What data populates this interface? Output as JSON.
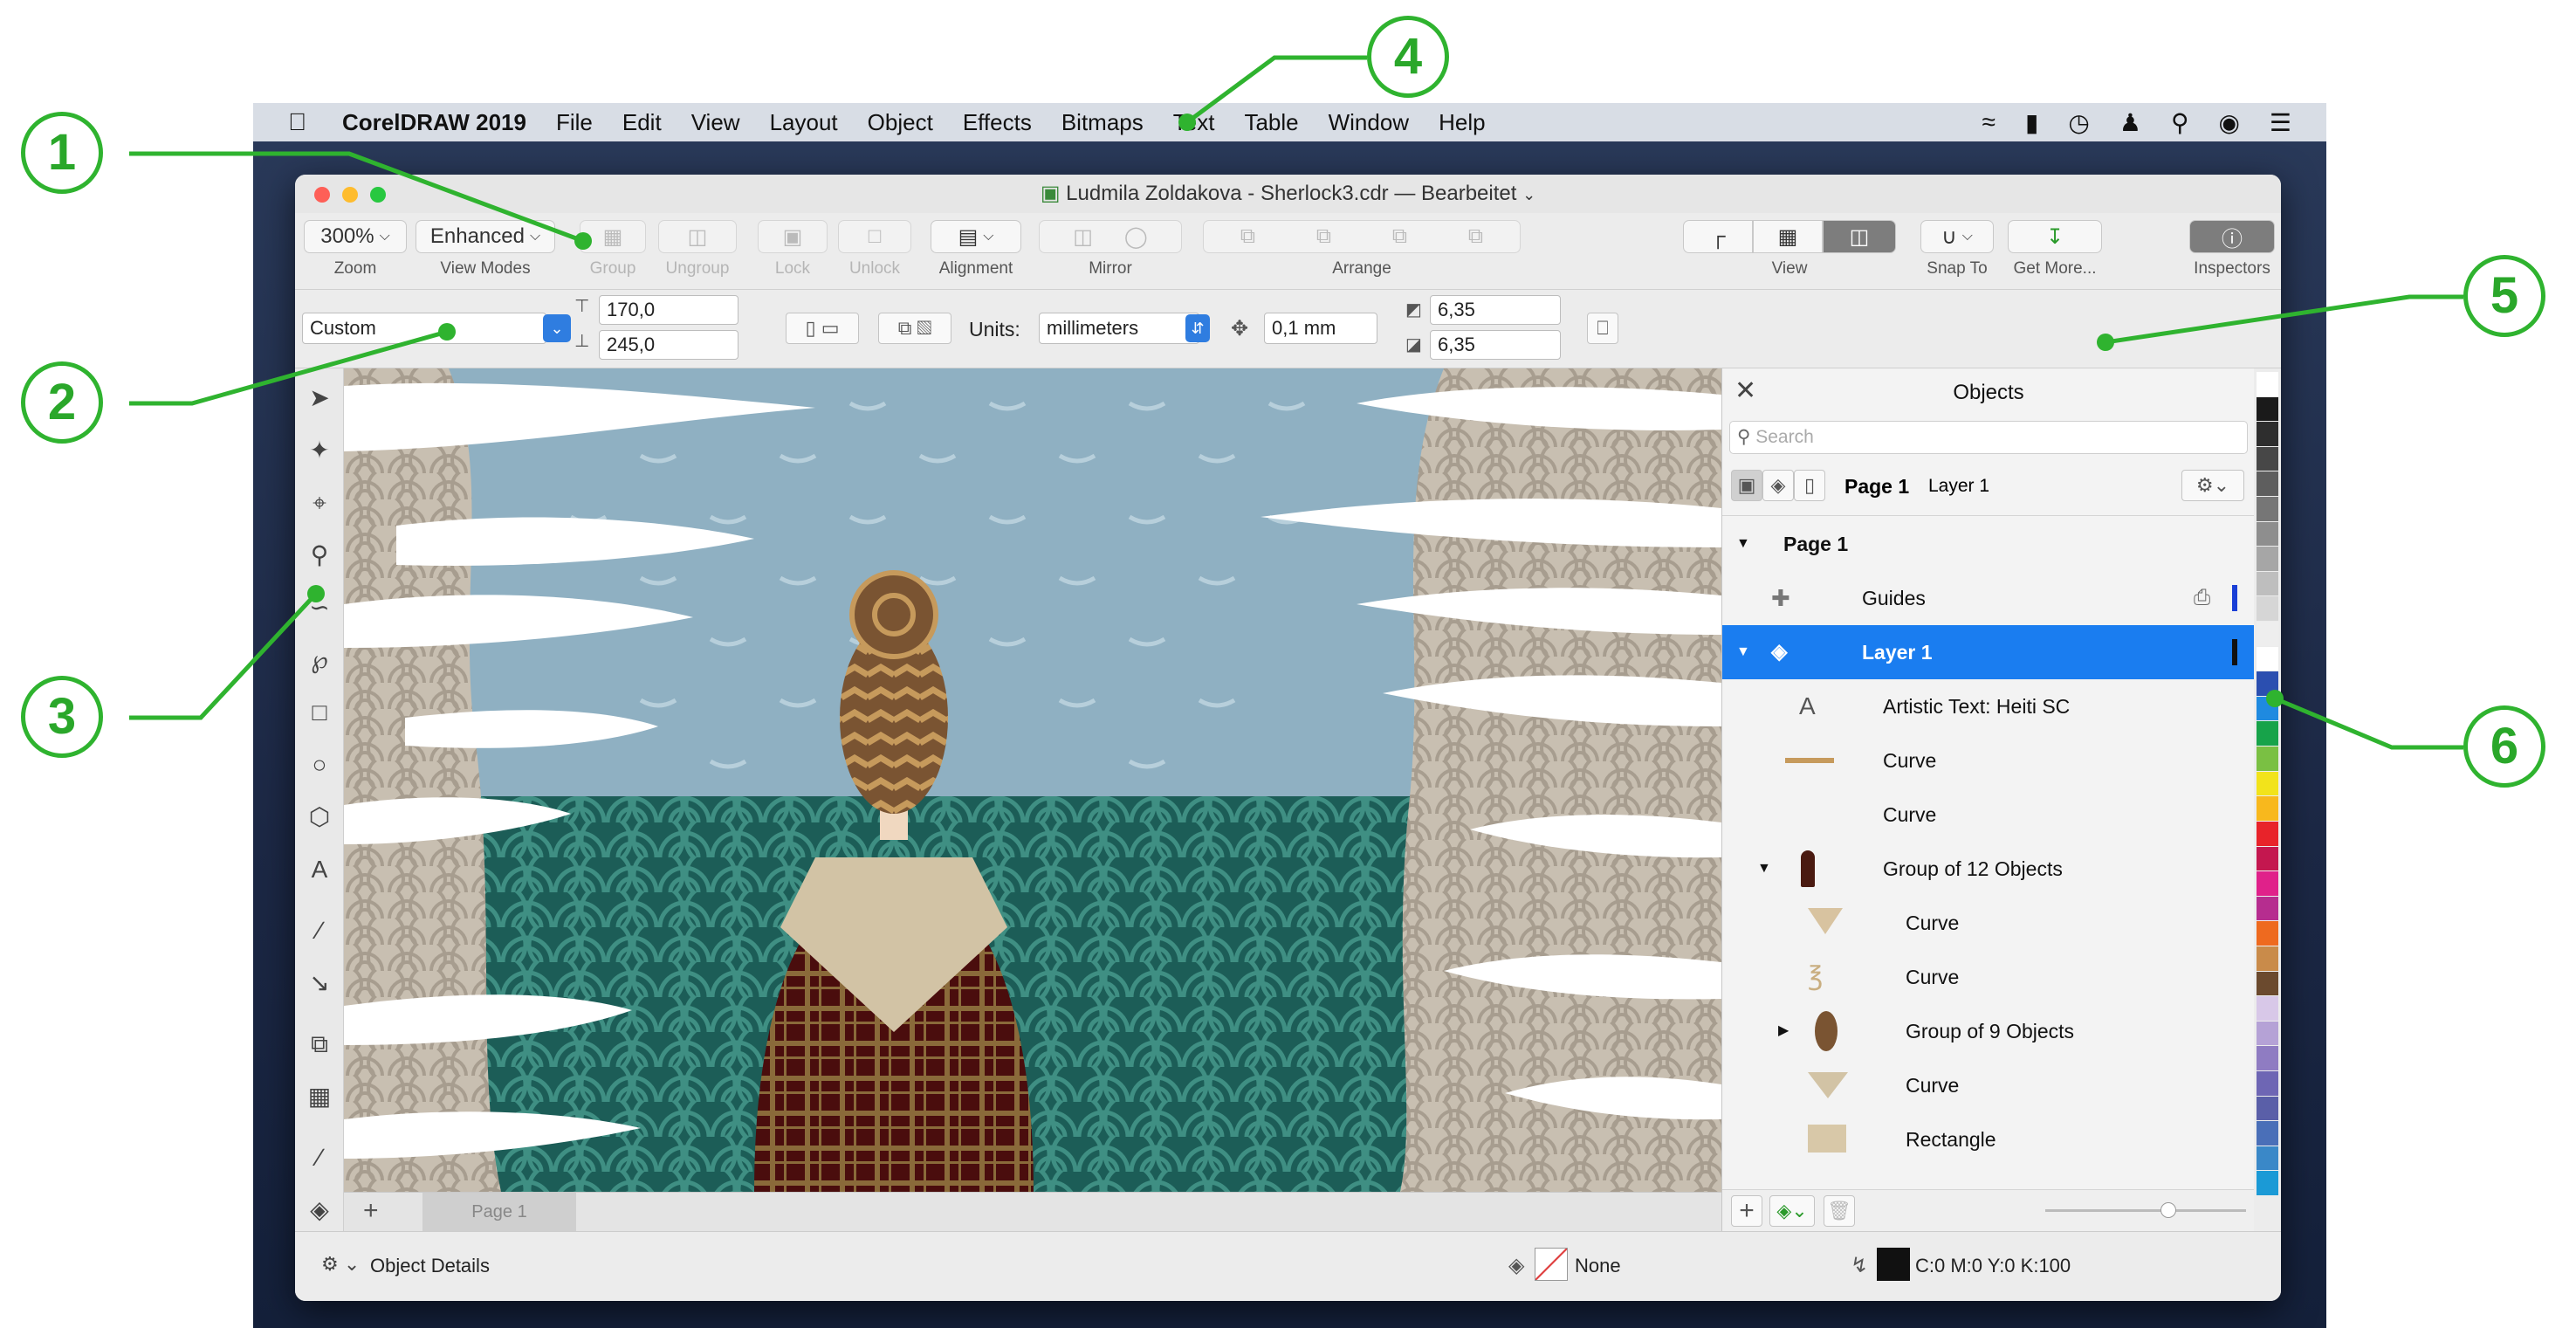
{
  "menubar": {
    "app": "CorelDRAW 2019",
    "items": [
      "File",
      "Edit",
      "View",
      "Layout",
      "Object",
      "Effects",
      "Bitmaps",
      "Text",
      "Table",
      "Window",
      "Help"
    ]
  },
  "window": {
    "title": "Ludmila Zoldakova - Sherlock3.cdr — Bearbeitet"
  },
  "toolbar": {
    "zoom_value": "300%",
    "zoom_label": "Zoom",
    "viewmode_value": "Enhanced",
    "viewmode_label": "View Modes",
    "group_label": "Group",
    "ungroup_label": "Ungroup",
    "lock_label": "Lock",
    "unlock_label": "Unlock",
    "alignment_label": "Alignment",
    "mirror_label": "Mirror",
    "arrange_label": "Arrange",
    "view_label": "View",
    "snap_label": "Snap To",
    "getmore_label": "Get More...",
    "inspectors_label": "Inspectors"
  },
  "propertybar": {
    "page_size": "Custom",
    "width": "170,0",
    "height": "245,0",
    "units_label": "Units:",
    "units_value": "millimeters",
    "nudge": "0,1 mm",
    "dup_x": "6,35",
    "dup_y": "6,35"
  },
  "pagetab": {
    "label": "Page 1"
  },
  "objects": {
    "title": "Objects",
    "search_placeholder": "Search",
    "current_page": "Page 1",
    "current_layer": "Layer 1",
    "rows": [
      {
        "label": "Page 1"
      },
      {
        "label": "Guides"
      },
      {
        "label": "Layer 1"
      },
      {
        "label": "Artistic Text: Heiti SC"
      },
      {
        "label": "Curve"
      },
      {
        "label": "Curve"
      },
      {
        "label": "Group of 12 Objects"
      },
      {
        "label": "Curve"
      },
      {
        "label": "Curve"
      },
      {
        "label": "Group of 9 Objects"
      },
      {
        "label": "Curve"
      },
      {
        "label": "Rectangle"
      }
    ]
  },
  "status": {
    "object_details": "Object Details",
    "fill": "None",
    "outline": "C:0 M:0 Y:0 K:100"
  },
  "callouts": [
    "1",
    "2",
    "3",
    "4",
    "5",
    "6"
  ],
  "colors": {
    "accent": "#1a7df0",
    "callout": "#2fb32f",
    "sky": "#8fb0c2",
    "sea": "#1c5d57",
    "coat": "#4a0d0d",
    "hair": "#7a5432"
  },
  "palette": [
    "#ffffff",
    "#1a1a1a",
    "#2e2e2e",
    "#474747",
    "#5e5e5e",
    "#767676",
    "#8e8e8e",
    "#a6a6a6",
    "#bebebe",
    "#d6d6d6",
    "#eeeeee",
    "#ffffff",
    "#2b4fb0",
    "#1f8ae0",
    "#17a34a",
    "#7ac043",
    "#f2e31b",
    "#f8b81d",
    "#e8232a",
    "#c4174f",
    "#e0218a",
    "#b62d8f",
    "#ee6a1f",
    "#c98b4a",
    "#6b4a2e",
    "#d8c8e8",
    "#b5a2d6",
    "#8f7cc2",
    "#6e66b4",
    "#5a5fa8",
    "#4a6fb8",
    "#3a88c8",
    "#1b9ad6"
  ]
}
